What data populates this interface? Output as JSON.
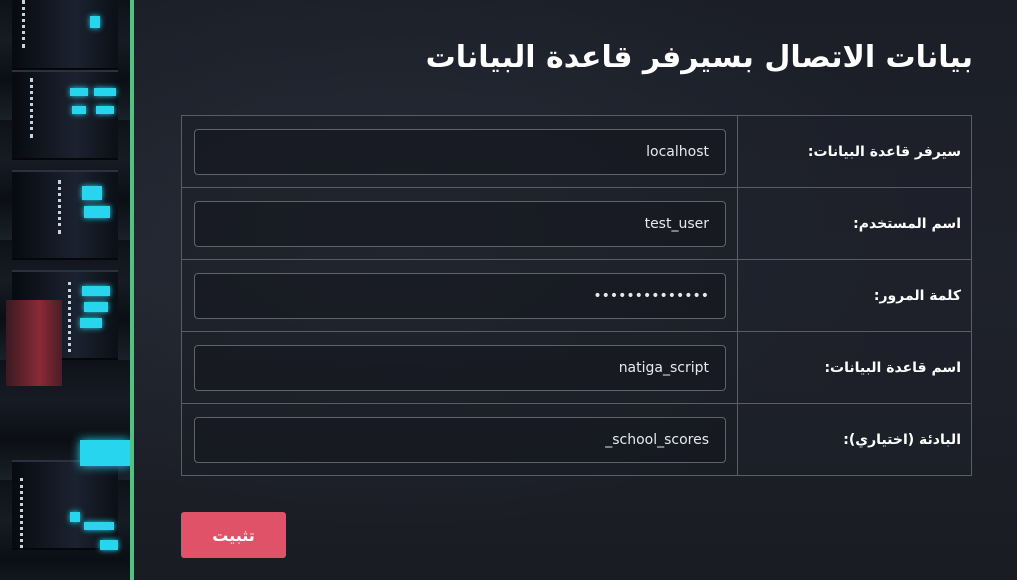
{
  "form": {
    "title": "بيانات الاتصال بسيرفر قاعدة البيانات",
    "fields": [
      {
        "label": "سيرفر قاعدة البيانات:",
        "value": "localhost",
        "type": "text"
      },
      {
        "label": "اسم المستخدم:",
        "value": "test_user",
        "type": "text"
      },
      {
        "label": "كلمة المرور:",
        "value": "passwordpasswo",
        "type": "password"
      },
      {
        "label": "اسم قاعدة البيانات:",
        "value": "natiga_script",
        "type": "text"
      },
      {
        "label": "البادئة (اختياري):",
        "value": "_school_scores",
        "type": "text"
      }
    ],
    "submit_label": "تثبيت"
  },
  "colors": {
    "accent_divider": "#4fc37f",
    "submit_button": "#e05268",
    "background": "#1b1d25"
  }
}
